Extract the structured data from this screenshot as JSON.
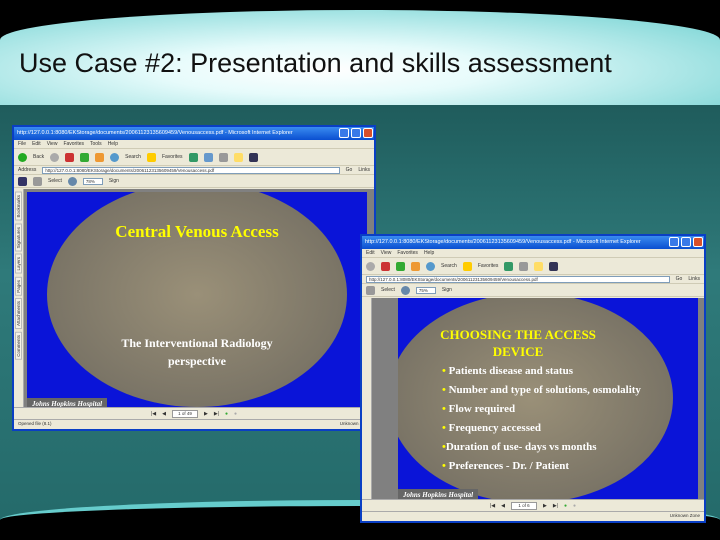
{
  "slide": {
    "title": "Use Case #2: Presentation and skills assessment"
  },
  "window1": {
    "title": "http://127.0.0.1:8080/EKStorage/documents/20061123135609459/Venousaccess.pdf - Microsoft Internet Explorer",
    "menu": [
      "File",
      "Edit",
      "View",
      "Favorites",
      "Tools",
      "Help"
    ],
    "toolbar": {
      "back": "Back",
      "search": "Search",
      "favorites": "Favorites"
    },
    "address_label": "Address",
    "address": "http://127.0.0.1:8080/EKStorage/documents/20061123135609459/Venousaccess.pdf",
    "go": "Go",
    "links": "Links",
    "pdf_toolbar": {
      "select": "Select",
      "zoom": "78%",
      "sign": "Sign"
    },
    "sidebar_tabs": [
      "Bookmarks",
      "Signatures",
      "Layers",
      "Pages",
      "Attachments",
      "Comments"
    ],
    "pdf_slide": {
      "heading": "Central Venous Access",
      "subtitle_1": "The Interventional Radiology",
      "subtitle_2": "perspective",
      "footer": "Johns Hopkins Hospital"
    },
    "page": "1 of 49",
    "status_left": "Opened file (8.1)",
    "status_right": "Unknown Zone"
  },
  "window2": {
    "title": "http://127.0.0.1:8080/EKStorage/documents/20061123135609459/Venousaccess.pdf - Microsoft Internet Explorer",
    "menu": [
      "Edit",
      "View",
      "Favorites",
      "Help"
    ],
    "toolbar": {
      "search": "Search",
      "favorites": "Favorites"
    },
    "address": "http://127.0.0.1:8080/EKStorage/documents/20061123135609459/Venousaccess.pdf",
    "go": "Go",
    "links": "Links",
    "pdf_toolbar": {
      "select": "Select",
      "zoom": "75%",
      "sign": "Sign"
    },
    "pdf_slide": {
      "heading_1": "CHOOSING THE ACCESS",
      "heading_2": "DEVICE",
      "bullets": [
        "Patients disease and status",
        "Number and type of solutions, osmolality",
        "Flow required",
        "Frequency accessed",
        "Duration of use- days vs months",
        "Preferences - Dr. / Patient"
      ],
      "footer": "Johns Hopkins Hospital"
    },
    "page": "1 of 6",
    "status_right": "Unknown Zone"
  }
}
